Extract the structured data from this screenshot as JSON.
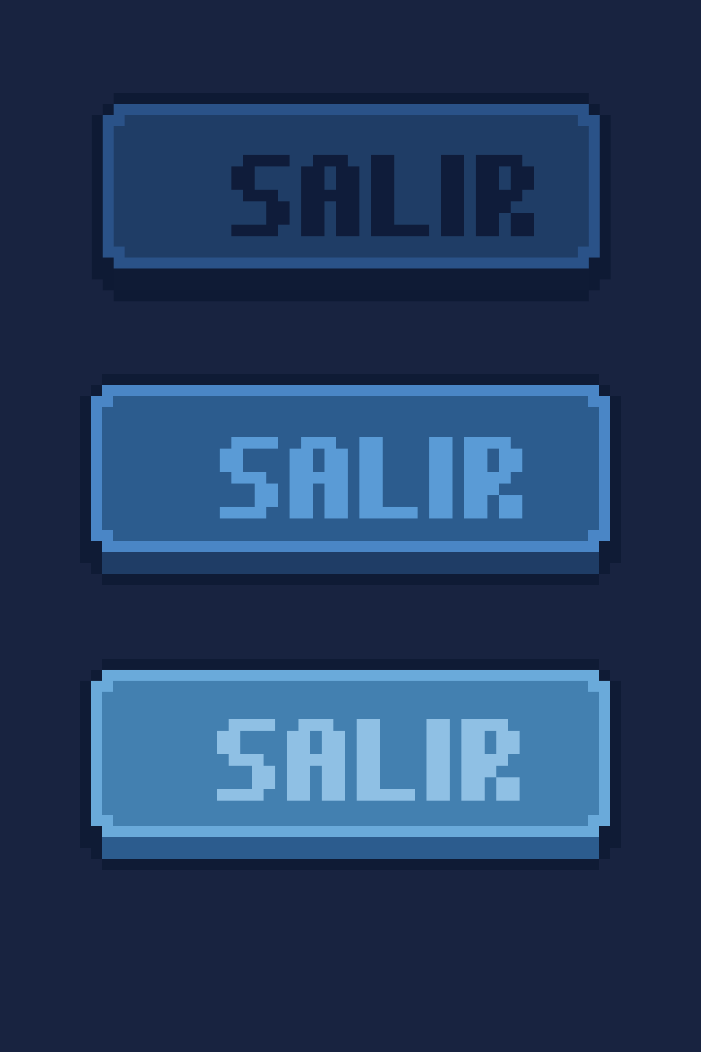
{
  "screen": {
    "background": "#182340"
  },
  "buttons": [
    {
      "state": "pressed",
      "label": "SALIR",
      "colors": {
        "outline": "#0e1a34",
        "shadow": "#0f1b35",
        "rim": "#2a5288",
        "face": "#1f3d66",
        "text": "#0f1c3a"
      }
    },
    {
      "state": "normal",
      "label": "SALIR",
      "colors": {
        "outline": "#0f1b35",
        "shadow": "#1f3d66",
        "rim": "#4a86c6",
        "face": "#2c5c8e",
        "text": "#5a9bd6"
      }
    },
    {
      "state": "hover",
      "label": "SALIR",
      "colors": {
        "outline": "#0f1b35",
        "shadow": "#2c5c8e",
        "rim": "#6aaada",
        "face": "#4380b0",
        "text": "#8fc0e4"
      }
    }
  ]
}
